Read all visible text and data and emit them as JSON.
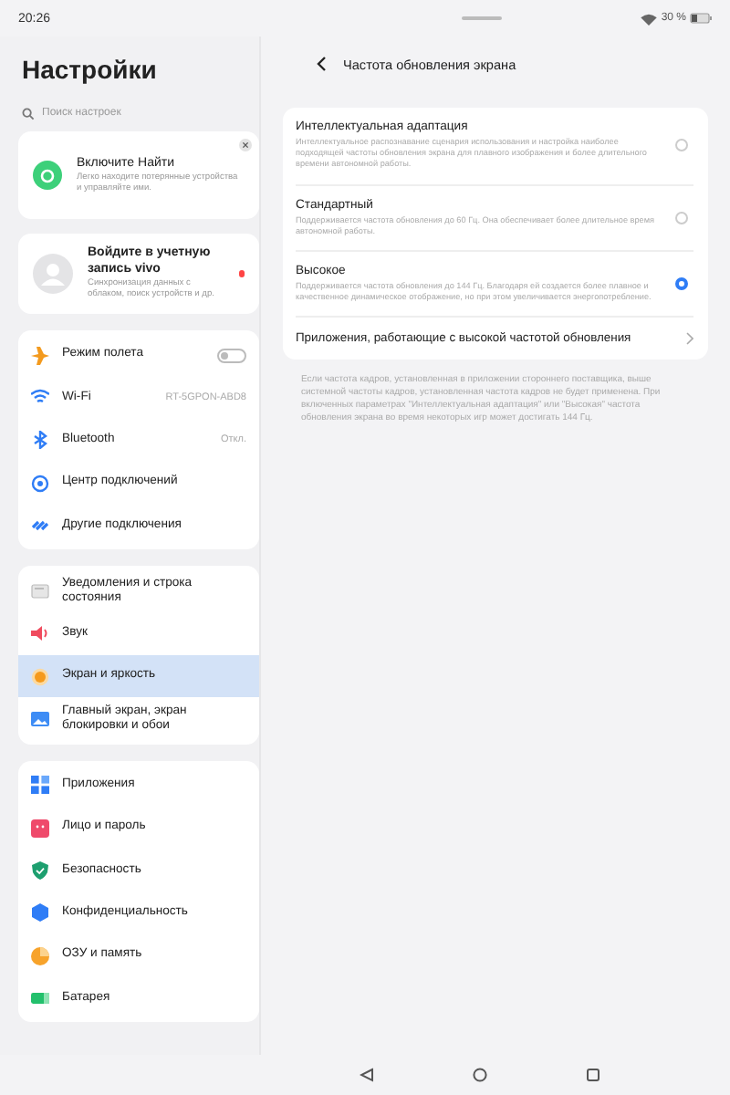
{
  "status_bar": {
    "time": "20:26",
    "battery": "30 %"
  },
  "sidebar": {
    "title": "Настройки",
    "search": {
      "placeholder": "Поиск настроек"
    },
    "promo": {
      "title": "Включите Найти",
      "text": "Легко находите потерянные устройства и управляйте ими."
    },
    "account": {
      "title": "Войдите в учетную запись vivo",
      "text": "Синхронизация данных с облаком, поиск устройств и др.",
      "notice": true
    },
    "groups": [
      [
        {
          "label": "Режим полета",
          "kind": "toggle",
          "on": false,
          "selected": false
        },
        {
          "label": "Wi-Fi",
          "kind": "value",
          "value": "RT-5GPON-ABD8",
          "selected": false
        },
        {
          "label": "Bluetooth",
          "kind": "value",
          "value": "Откл.",
          "selected": false
        },
        {
          "label": "Центр подключений",
          "kind": "plain",
          "selected": false
        },
        {
          "label": "Другие подключения",
          "kind": "plain",
          "selected": false
        }
      ],
      [
        {
          "label": "Уведомления и строка состояния",
          "kind": "plain",
          "selected": false
        },
        {
          "label": "Звук",
          "kind": "plain",
          "selected": false
        },
        {
          "label": "Экран и яркость",
          "kind": "plain",
          "selected": true
        },
        {
          "label": "Главный экран, экран блокировки и обои",
          "kind": "plain",
          "selected": false
        }
      ],
      [
        {
          "label": "Приложения",
          "kind": "plain",
          "selected": false
        },
        {
          "label": "Лицо и пароль",
          "kind": "plain",
          "selected": false
        },
        {
          "label": "Безопасность",
          "kind": "plain",
          "selected": false
        },
        {
          "label": "Конфиденциальность",
          "kind": "plain",
          "selected": false
        },
        {
          "label": "ОЗУ и память",
          "kind": "plain",
          "selected": false
        },
        {
          "label": "Батарея",
          "kind": "plain",
          "selected": false
        }
      ]
    ]
  },
  "detail": {
    "title": "Частота обновления экрана",
    "options": [
      {
        "title": "Интеллектуальная адаптация",
        "text": "Интеллектуальное распознавание сценария использования и настройка наиболее подходящей частоты обновления экрана для плавного изображения и более длительного времени автономной работы.",
        "selected": false
      },
      {
        "title": "Стандартный",
        "text": "Поддерживается частота обновления до 60 Гц. Она обеспечивает более длительное время автономной работы.",
        "selected": false
      },
      {
        "title": "Высокое",
        "text": "Поддерживается частота обновления до 144 Гц. Благодаря ей создается более плавное и качественное динамическое отображение, но при этом увеличивается энергопотребление.",
        "selected": true
      }
    ],
    "link": "Приложения, работающие с высокой частотой обновления",
    "note": "Если частота кадров, установленная в приложении стороннего поставщика, выше системной частоты кадров, установленная частота кадров не будет применена. При включенных параметрах \"Интеллектуальная адаптация\" или \"Высокая\" частота обновления экрана во время некоторых игр может достигать 144 Гц."
  }
}
